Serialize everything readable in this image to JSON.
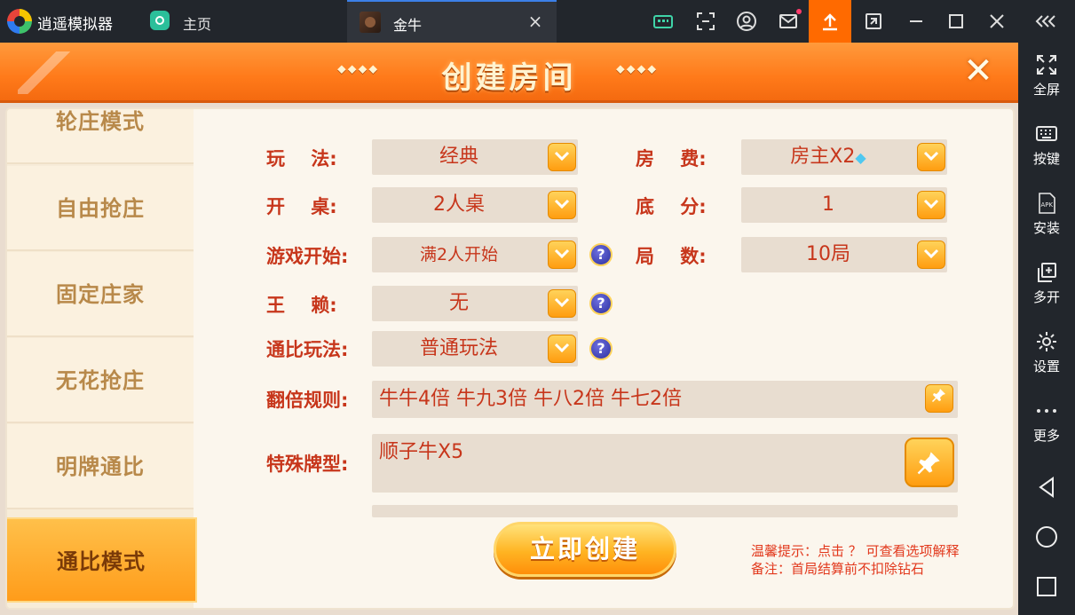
{
  "titlebar": {
    "app_name": "逍遥模拟器",
    "home_label": "主页",
    "active_tab": "金牛",
    "close_tab_symbol": "×",
    "icons": [
      "keyboard-mapping-icon",
      "screenshot-icon",
      "account-icon",
      "mail-icon",
      "upload-icon",
      "rotate-icon",
      "minimize-icon",
      "maximize-icon",
      "close-icon",
      "collapse-icon"
    ]
  },
  "right_sidebar": {
    "items": [
      {
        "label": "全屏",
        "icon": "fullscreen-icon"
      },
      {
        "label": "按键",
        "icon": "keyboard-icon"
      },
      {
        "label": "安装",
        "icon": "apk-install-icon"
      },
      {
        "label": "多开",
        "icon": "multi-instance-icon"
      },
      {
        "label": "设置",
        "icon": "settings-icon"
      },
      {
        "label": "更多",
        "icon": "more-icon"
      }
    ],
    "nav": [
      "back-icon",
      "home-circle-icon",
      "recents-icon"
    ]
  },
  "dialog": {
    "title": "创建房间",
    "deco_left": "⬥⬥⬥⬥",
    "deco_right": "⬥⬥⬥⬥",
    "close_symbol": "✕"
  },
  "modes": {
    "items": [
      "轮庄模式",
      "自由抢庄",
      "固定庄家",
      "无花抢庄",
      "明牌通比",
      "通比模式"
    ],
    "active_index": 5
  },
  "form": {
    "play_label": "玩    法:",
    "play_value": "经典",
    "fee_label": "房    费:",
    "fee_value": "房主X2",
    "table_label": "开    桌:",
    "table_value": "2人桌",
    "base_label": "底    分:",
    "base_value": "1",
    "start_label": "游戏开始:",
    "start_value": "满2人开始",
    "rounds_label": "局    数:",
    "rounds_value": "10局",
    "wild_label": "王    赖:",
    "wild_value": "无",
    "compare_label": "通比玩法:",
    "compare_value": "普通玩法",
    "multiplier_label": "翻倍规则:",
    "multiplier_value": "牛牛4倍 牛九3倍 牛八2倍 牛七2倍",
    "special_label": "特殊牌型:",
    "special_value": "顺子牛X5",
    "help_symbol": "?",
    "dropdown_symbol": "v"
  },
  "create_button": "立即创建",
  "tips": {
    "line1": "温馨提示：点击 ？  可查看选项解释",
    "line2": "备注：首局结算前不扣除钻石"
  },
  "colors": {
    "header_orange": "#ff7a1a",
    "label_red": "#c7361b",
    "accent_gold": "#ffb422",
    "upload_orange": "#ff6a00"
  }
}
